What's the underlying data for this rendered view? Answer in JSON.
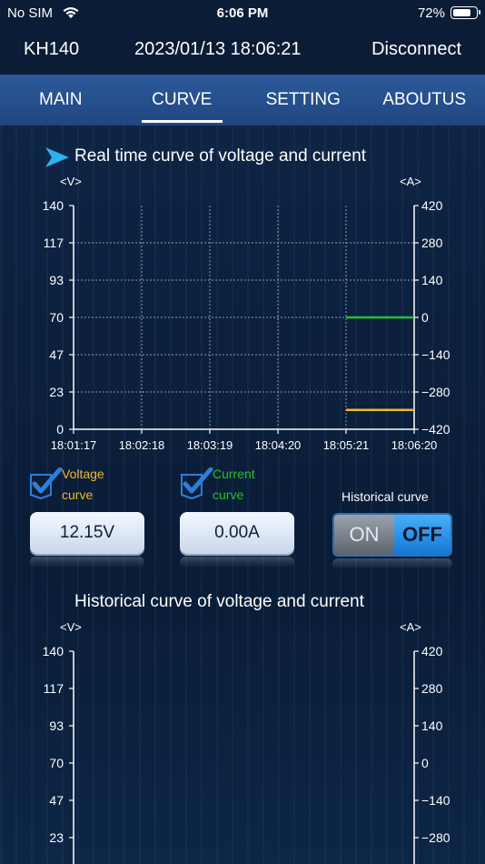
{
  "status_bar": {
    "carrier": "No SIM",
    "time": "6:06 PM",
    "battery": "72%"
  },
  "header": {
    "device": "KH140",
    "datetime": "2023/01/13 18:06:21",
    "disconnect": "Disconnect"
  },
  "tabs": [
    {
      "label": "MAIN",
      "active": false
    },
    {
      "label": "CURVE",
      "active": true
    },
    {
      "label": "SETTING",
      "active": false
    },
    {
      "label": "ABOUTUS",
      "active": false
    }
  ],
  "realtime": {
    "title": "Real time curve of voltage and current",
    "left_unit": "<V>",
    "right_unit": "<A>"
  },
  "controls": {
    "voltage_check_label_1": "Voltage",
    "voltage_check_label_2": "curve",
    "current_check_label_1": "Current",
    "current_check_label_2": "curve",
    "voltage_value": "12.15V",
    "current_value": "0.00A",
    "historical_label": "Historical curve",
    "toggle_on": "ON",
    "toggle_off": "OFF",
    "voltage_color": "#f0b82a",
    "current_color": "#22c22a",
    "toggle_state": "off"
  },
  "historical": {
    "title": "Historical curve of voltage and current",
    "left_unit": "<V>",
    "right_unit": "<A>"
  },
  "chart_data": [
    {
      "type": "line",
      "title": "Real time curve of voltage and current",
      "x": [
        "18:01:17",
        "18:02:18",
        "18:03:19",
        "18:04:20",
        "18:05:21",
        "18:06:20"
      ],
      "y_left_ticks": [
        "140",
        "117",
        "93",
        "70",
        "47",
        "23",
        "0"
      ],
      "y_right_ticks": [
        "420",
        "280",
        "140",
        "0",
        "−140",
        "−280",
        "−420"
      ],
      "ylim_left": [
        0,
        140
      ],
      "ylim_right": [
        -420,
        420
      ],
      "grid": true,
      "series": [
        {
          "axis": "right",
          "color": "#22c22a",
          "x": [
            "18:05:21",
            "18:06:20"
          ],
          "values": [
            0,
            0
          ]
        },
        {
          "axis": "left",
          "color": "#f0b82a",
          "x": [
            "18:05:21",
            "18:06:20"
          ],
          "values": [
            12.15,
            12.15
          ]
        }
      ]
    },
    {
      "type": "line",
      "title": "Historical curve of voltage and current",
      "y_left_ticks": [
        "140",
        "117",
        "93",
        "70",
        "47",
        "23"
      ],
      "y_right_ticks": [
        "420",
        "280",
        "140",
        "0",
        "−140",
        "−280"
      ],
      "ylim_left": [
        0,
        140
      ],
      "ylim_right": [
        -420,
        420
      ],
      "grid": false,
      "series": []
    }
  ]
}
